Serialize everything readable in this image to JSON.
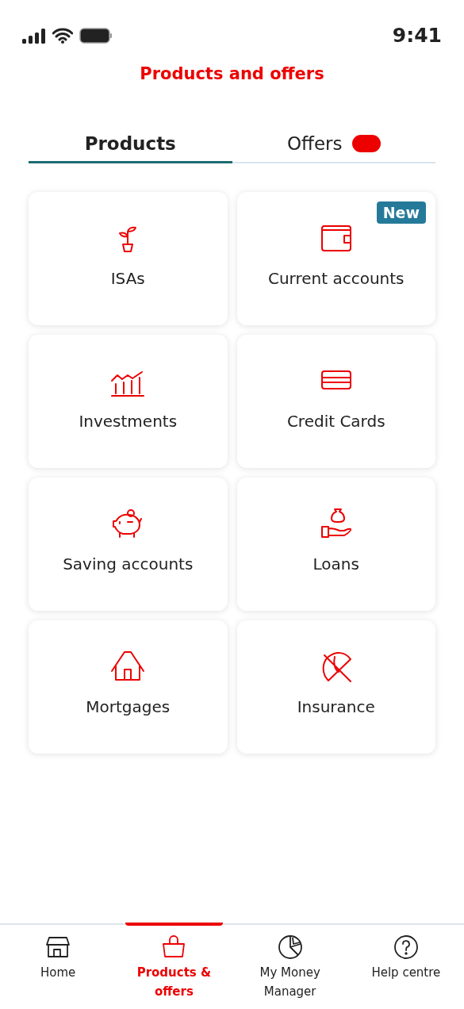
{
  "status_bar": {
    "time": "9:41"
  },
  "title": "Products and offers",
  "tabs": [
    {
      "label": "Products",
      "selected": true,
      "badge": false
    },
    {
      "label": "Offers",
      "selected": false,
      "badge": true
    }
  ],
  "badge_label": "New",
  "tiles": [
    {
      "kind": "plant",
      "label": "ISAs",
      "badge": false
    },
    {
      "kind": "wallet",
      "label": "Current accounts",
      "badge": true
    },
    {
      "kind": "chart",
      "label": "Investments",
      "badge": false
    },
    {
      "kind": "card",
      "label": "Credit Cards",
      "badge": false
    },
    {
      "kind": "piggy",
      "label": "Saving accounts",
      "badge": false
    },
    {
      "kind": "hand",
      "label": "Loans",
      "badge": false
    },
    {
      "kind": "house",
      "label": "Mortgages",
      "badge": false
    },
    {
      "kind": "umbrella",
      "label": "Insurance",
      "badge": false
    }
  ],
  "nav": [
    {
      "kind": "home",
      "label": "Home",
      "selected": false
    },
    {
      "kind": "bag",
      "label": "Products & offers",
      "selected": true
    },
    {
      "kind": "pie",
      "label": "My Money Manager",
      "selected": false
    },
    {
      "kind": "help",
      "label": "Help centre",
      "selected": false
    }
  ]
}
